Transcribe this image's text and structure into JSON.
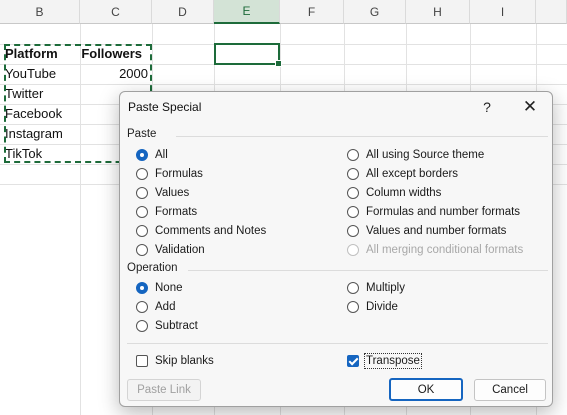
{
  "sheet": {
    "columns": [
      "B",
      "C",
      "D",
      "E",
      "F",
      "G",
      "H",
      "I"
    ],
    "active_column": "E",
    "table": {
      "headers": [
        "Platform",
        "Followers"
      ],
      "rows": [
        {
          "platform": "YouTube",
          "followers": "2000"
        },
        {
          "platform": "Twitter",
          "followers": ""
        },
        {
          "platform": "Facebook",
          "followers": ""
        },
        {
          "platform": "Instagram",
          "followers": ""
        },
        {
          "platform": "TikTok",
          "followers": ""
        }
      ]
    }
  },
  "dialog": {
    "title": "Paste Special",
    "help_glyph": "?",
    "close_glyph": "✕",
    "paste_group": {
      "label": "Paste",
      "left_options": [
        {
          "label": "All",
          "checked": true
        },
        {
          "label": "Formulas",
          "checked": false
        },
        {
          "label": "Values",
          "checked": false
        },
        {
          "label": "Formats",
          "checked": false
        },
        {
          "label": "Comments and Notes",
          "checked": false
        },
        {
          "label": "Validation",
          "checked": false
        }
      ],
      "right_options": [
        {
          "label": "All using Source theme",
          "checked": false,
          "disabled": false
        },
        {
          "label": "All except borders",
          "checked": false,
          "disabled": false
        },
        {
          "label": "Column widths",
          "checked": false,
          "disabled": false
        },
        {
          "label": "Formulas and number formats",
          "checked": false,
          "disabled": false
        },
        {
          "label": "Values and number formats",
          "checked": false,
          "disabled": false
        },
        {
          "label": "All merging conditional formats",
          "checked": false,
          "disabled": true
        }
      ]
    },
    "operation_group": {
      "label": "Operation",
      "left_options": [
        {
          "label": "None",
          "checked": true
        },
        {
          "label": "Add",
          "checked": false
        },
        {
          "label": "Subtract",
          "checked": false
        }
      ],
      "right_options": [
        {
          "label": "Multiply",
          "checked": false
        },
        {
          "label": "Divide",
          "checked": false
        }
      ]
    },
    "skip_blanks": {
      "label": "Skip blanks",
      "checked": false
    },
    "transpose": {
      "label": "Transpose",
      "checked": true
    },
    "buttons": {
      "paste_link": "Paste Link",
      "ok": "OK",
      "cancel": "Cancel"
    }
  },
  "colors": {
    "accent": "#1565c0",
    "excel_green": "#1d6b3a"
  }
}
